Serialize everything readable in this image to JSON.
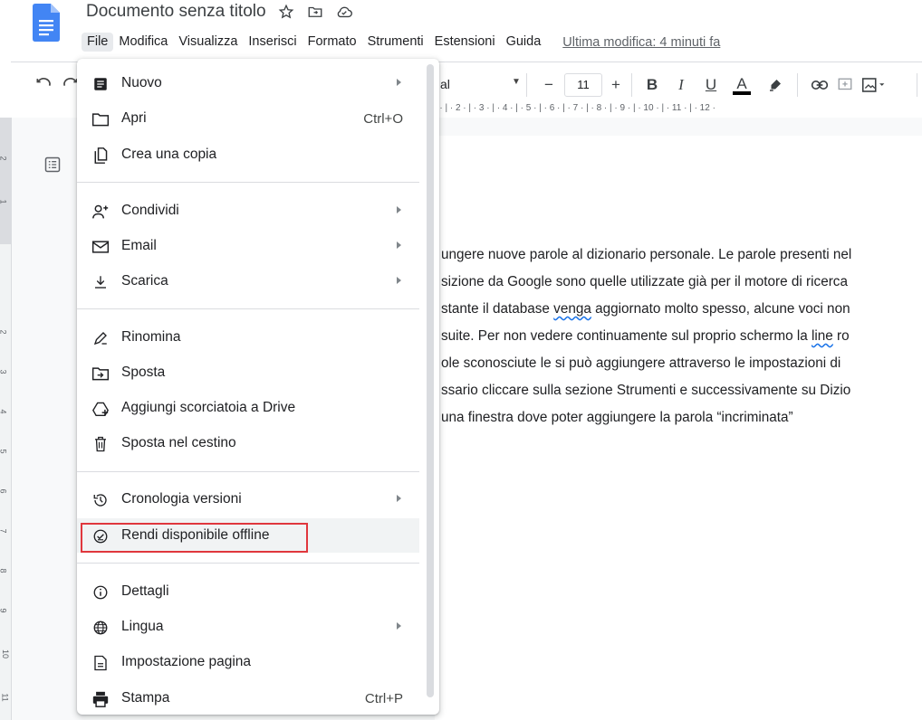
{
  "header": {
    "doc_title": "Documento senza titolo",
    "menus": [
      "File",
      "Modifica",
      "Visualizza",
      "Inserisci",
      "Formato",
      "Strumenti",
      "Estensioni",
      "Guida"
    ],
    "last_edit": "Ultima modifica: 4 minuti fa",
    "icons": [
      "star-icon",
      "move-to-folder-icon",
      "cloud-status-icon"
    ]
  },
  "toolbar": {
    "font_name": "al",
    "font_size": "11",
    "minus": "−",
    "plus": "+",
    "bold": "B",
    "italic": "I",
    "underline": "U",
    "text_color": "A",
    "text_color_value": "#000000"
  },
  "ruler": {
    "top_marks": "|  ·  |  ·  2 ·  |  ·  3 ·  |  ·  4 ·  |  ·  5 ·  |  ·  6 ·  |  ·  7 ·  |  ·  8 ·  |  ·  9 ·  |  · 10 ·  |  · 11 ·  |  · 12 ·",
    "left_marks": [
      "2",
      "1",
      "2",
      "3",
      "4",
      "5",
      "6",
      "7",
      "8",
      "9",
      "10",
      "11"
    ]
  },
  "document": {
    "lines": [
      {
        "text": "ungere nuove parole al dizionario personale. Le parole presenti nel"
      },
      {
        "text": "sizione da Google sono quelle utilizzate già per il motore di ricerca"
      },
      {
        "pre": "stante il database ",
        "squiggle": "venga",
        "post": " aggiornato molto spesso, alcune voci non"
      },
      {
        "pre": "suite. Per non vedere continuamente sul proprio schermo la ",
        "squiggle": "line",
        "post": " ro"
      },
      {
        "text": "ole sconosciute le si può aggiungere attraverso le impostazioni di"
      },
      {
        "text": "ssario cliccare sulla sezione Strumenti e successivamente su Dizio"
      },
      {
        "text": "una finestra dove poter aggiungere la parola “incriminata”"
      }
    ]
  },
  "file_menu": {
    "items": [
      {
        "label": "Nuovo",
        "icon": "new-document-icon",
        "submenu": true
      },
      {
        "label": "Apri",
        "icon": "folder-icon",
        "shortcut": "Ctrl+O"
      },
      {
        "label": "Crea una copia",
        "icon": "copy-icon"
      },
      {
        "label": "Condividi",
        "icon": "share-person-icon",
        "submenu": true
      },
      {
        "label": "Email",
        "icon": "email-icon",
        "submenu": true
      },
      {
        "label": "Scarica",
        "icon": "download-icon",
        "submenu": true
      },
      {
        "label": "Rinomina",
        "icon": "rename-icon"
      },
      {
        "label": "Sposta",
        "icon": "move-icon"
      },
      {
        "label": "Aggiungi scorciatoia a Drive",
        "icon": "add-shortcut-drive-icon"
      },
      {
        "label": "Sposta nel cestino",
        "icon": "trash-icon"
      },
      {
        "label": "Cronologia versioni",
        "icon": "history-icon",
        "submenu": true
      },
      {
        "label": "Rendi disponibile offline",
        "icon": "offline-check-icon",
        "highlighted": true
      },
      {
        "label": "Dettagli",
        "icon": "info-icon"
      },
      {
        "label": "Lingua",
        "icon": "globe-icon",
        "submenu": true
      },
      {
        "label": "Impostazione pagina",
        "icon": "page-setup-icon"
      },
      {
        "label": "Stampa",
        "icon": "print-icon",
        "shortcut": "Ctrl+P"
      }
    ]
  }
}
